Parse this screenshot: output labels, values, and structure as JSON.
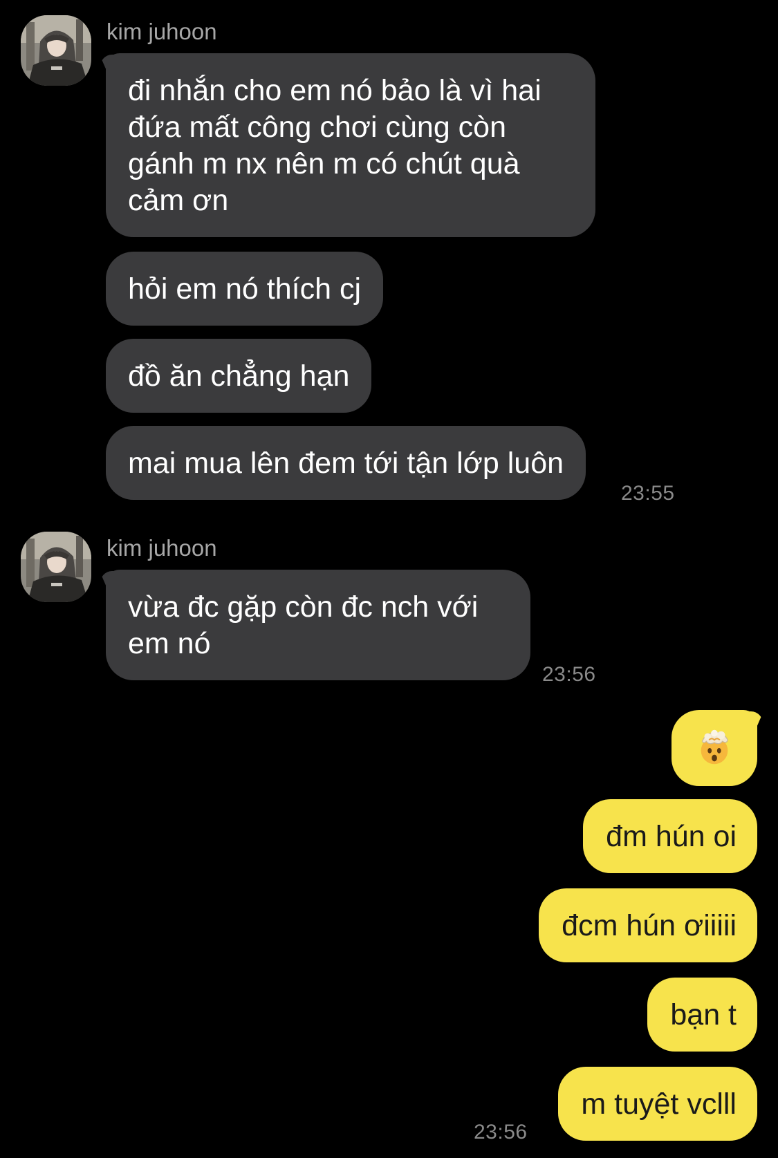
{
  "chat": {
    "group1": {
      "sender": "kim juhoon",
      "messages": [
        "đi nhắn cho em nó bảo là vì hai đứa mất công chơi cùng còn gánh m nx nên m có chút quà cảm ơn",
        "hỏi em nó thích cj",
        "đồ ăn chẳng hạn",
        "mai mua lên đem tới tận lớp luôn"
      ],
      "time": "23:55"
    },
    "group2": {
      "sender": "kim juhoon",
      "messages": [
        "vừa đc gặp còn đc nch với em nó"
      ],
      "time": "23:56"
    },
    "outgoing": {
      "emoji": "exploding-head-emoji",
      "messages": [
        "đm hún oi",
        "đcm hún ơiiiii",
        "bạn t",
        "m tuyệt vclll"
      ],
      "time": "23:56"
    }
  },
  "colors": {
    "background": "#000000",
    "incoming_bubble": "#3b3b3d",
    "outgoing_bubble": "#f7e34c",
    "sender_name": "#a7a7a7",
    "timestamp": "#8a8a8a"
  }
}
